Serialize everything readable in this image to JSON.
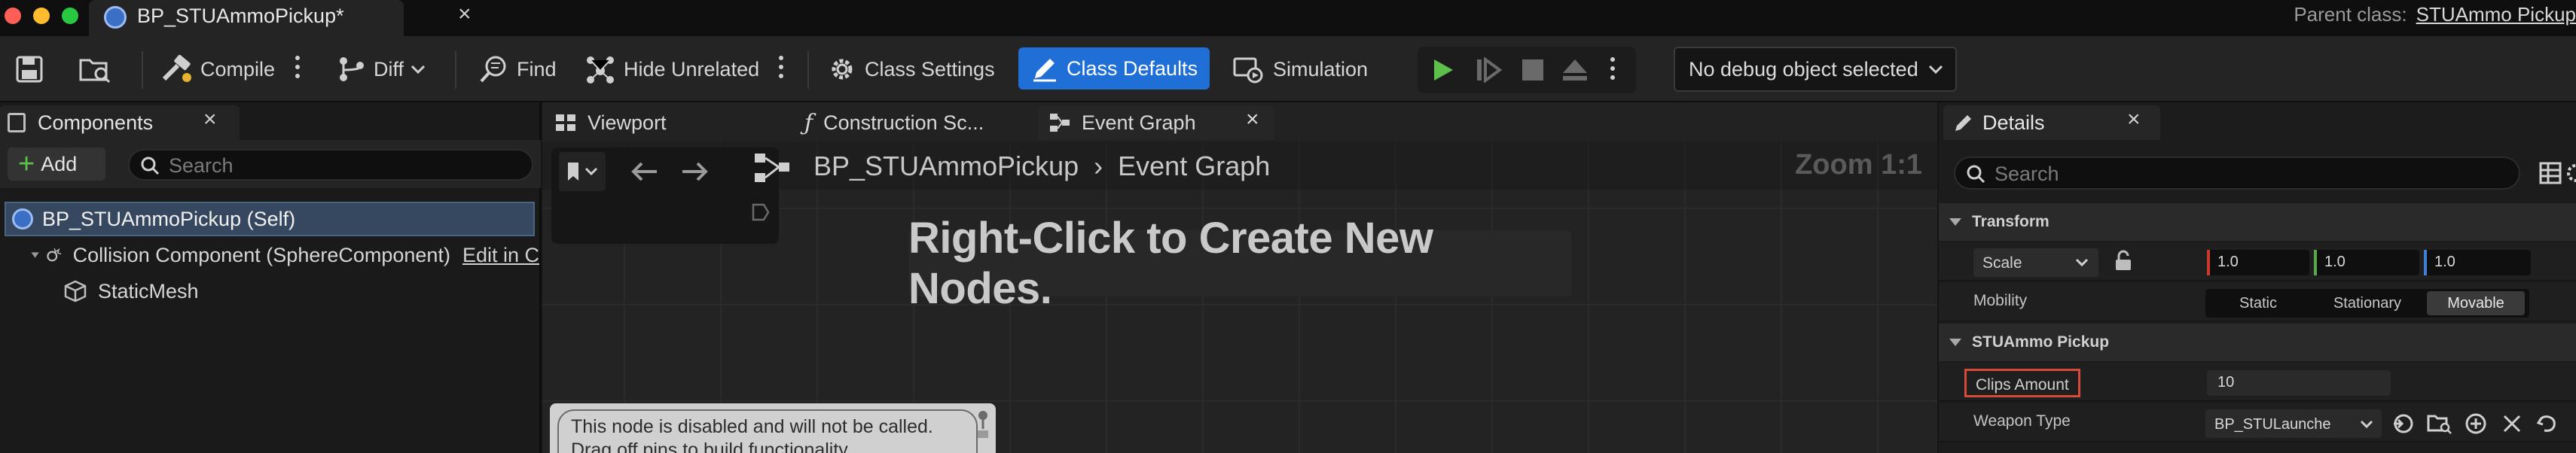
{
  "window": {
    "tab_title": "BP_STUAmmoPickup*",
    "parent_class_label": "Parent class:",
    "parent_class_value": "STUAmmo Pickup"
  },
  "toolbar": {
    "compile_label": "Compile",
    "diff_label": "Diff",
    "find_label": "Find",
    "hide_unrelated_label": "Hide Unrelated",
    "class_settings_label": "Class Settings",
    "class_defaults_label": "Class Defaults",
    "simulation_label": "Simulation",
    "debug_object_value": "No debug object selected"
  },
  "components": {
    "tab_label": "Components",
    "add_label": "Add",
    "search_placeholder": "Search",
    "tree": {
      "self": "BP_STUAmmoPickup (Self)",
      "collision": "Collision Component (SphereComponent)",
      "collision_edit": "Edit in C",
      "mesh": "StaticMesh"
    }
  },
  "editor_tabs": {
    "viewport": "Viewport",
    "construction": "Construction Sc...",
    "event_graph": "Event Graph"
  },
  "graph": {
    "breadcrumb_bp": "BP_STUAmmoPickup",
    "breadcrumb_graph": "Event Graph",
    "zoom": "Zoom 1:1",
    "hint": "Right-Click to Create New Nodes.",
    "disabled_line1": "This node is disabled and will not be called.",
    "disabled_line2": "Drag off pins to build functionality."
  },
  "details": {
    "tab_label": "Details",
    "search_placeholder": "Search",
    "transform_category": "Transform",
    "scale_label": "Scale",
    "scale_x": "1.0",
    "scale_y": "1.0",
    "scale_z": "1.0",
    "mobility_label": "Mobility",
    "mobility_options": [
      "Static",
      "Stationary",
      "Movable"
    ],
    "mobility_selected": "Movable",
    "pickup_category": "STUAmmo Pickup",
    "clips_label": "Clips Amount",
    "clips_value": "10",
    "weapon_label": "Weapon Type",
    "weapon_value": "BP_STULaunche"
  },
  "colors": {
    "accent_blue": "#1f6fd6",
    "play_green": "#5cc04a",
    "axis_x": "#c8392e",
    "axis_y": "#5aa84a",
    "axis_z": "#3f7fd8",
    "highlight_red": "#d64a3a"
  }
}
